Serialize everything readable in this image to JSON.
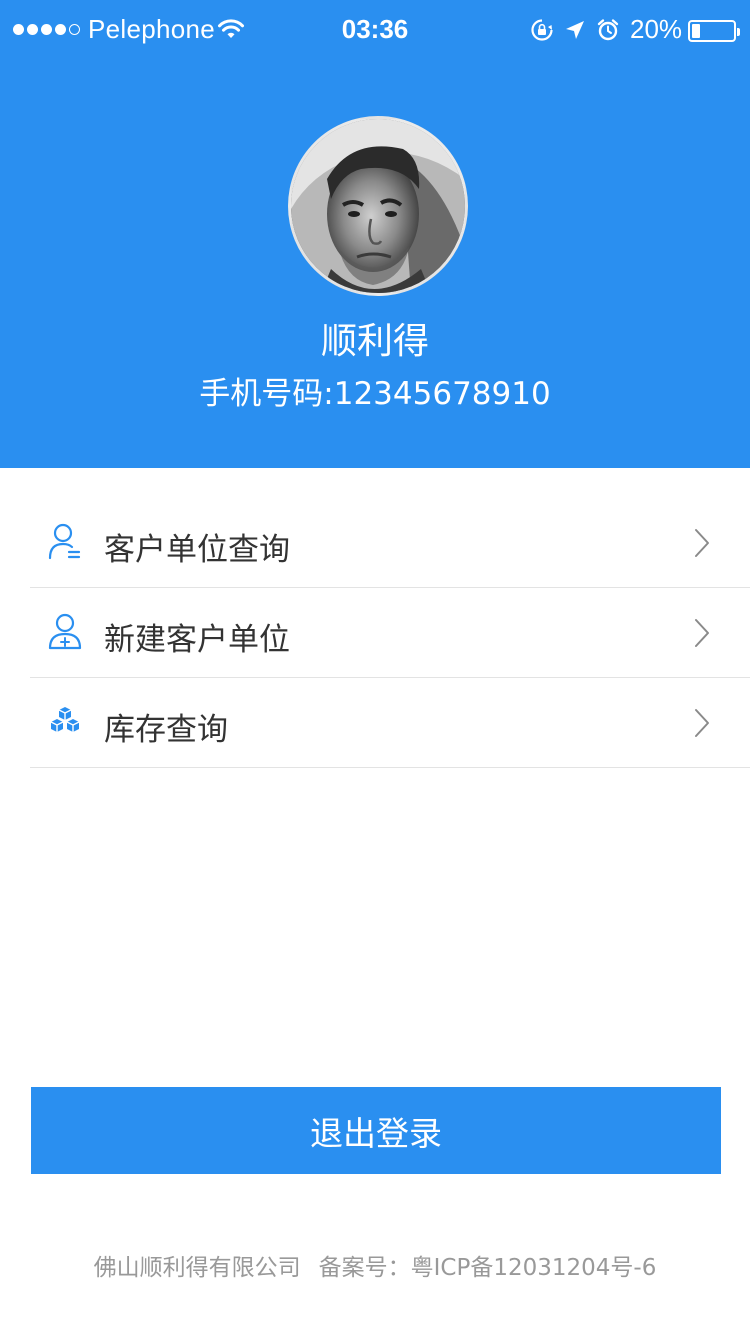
{
  "status_bar": {
    "carrier": "Pelephone",
    "time": "03:36",
    "battery_percent": "20%",
    "battery_level": 0.2,
    "signal_bars_filled": 4,
    "signal_bars_total": 5
  },
  "profile": {
    "name": "顺利得",
    "phone": "手机号码:12345678910"
  },
  "menu": {
    "items": [
      {
        "label": "客户单位查询",
        "icon": "user-list-icon"
      },
      {
        "label": "新建客户单位",
        "icon": "user-add-icon"
      },
      {
        "label": "库存查询",
        "icon": "boxes-icon"
      }
    ]
  },
  "logout": {
    "label": "退出登录"
  },
  "footer": {
    "company": "佛山顺利得有限公司",
    "record": "备案号：粤ICP备12031204号-6"
  },
  "colors": {
    "primary": "#2a8ff0",
    "icon_blue": "#2a8ff0",
    "text_dark": "#333333",
    "text_muted": "#999999",
    "divider": "#e3e3e3"
  }
}
